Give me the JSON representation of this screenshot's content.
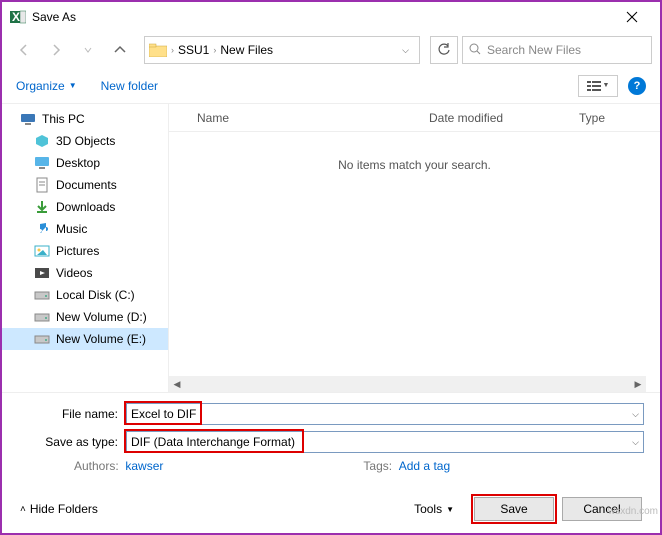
{
  "title": "Save As",
  "breadcrumbs": {
    "root_icon": "folder",
    "items": [
      "SSU1",
      "New Files"
    ]
  },
  "search": {
    "placeholder": "Search New Files"
  },
  "toolbar": {
    "organize": "Organize",
    "newfolder": "New folder"
  },
  "tree": [
    {
      "label": "This PC",
      "icon": "pc",
      "indent": false,
      "selected": false
    },
    {
      "label": "3D Objects",
      "icon": "3d",
      "indent": true,
      "selected": false
    },
    {
      "label": "Desktop",
      "icon": "desktop",
      "indent": true,
      "selected": false
    },
    {
      "label": "Documents",
      "icon": "documents",
      "indent": true,
      "selected": false
    },
    {
      "label": "Downloads",
      "icon": "downloads",
      "indent": true,
      "selected": false
    },
    {
      "label": "Music",
      "icon": "music",
      "indent": true,
      "selected": false
    },
    {
      "label": "Pictures",
      "icon": "pictures",
      "indent": true,
      "selected": false
    },
    {
      "label": "Videos",
      "icon": "videos",
      "indent": true,
      "selected": false
    },
    {
      "label": "Local Disk (C:)",
      "icon": "disk",
      "indent": true,
      "selected": false
    },
    {
      "label": "New Volume (D:)",
      "icon": "disk",
      "indent": true,
      "selected": false
    },
    {
      "label": "New Volume (E:)",
      "icon": "disk",
      "indent": true,
      "selected": true
    }
  ],
  "columns": {
    "name": "Name",
    "date": "Date modified",
    "type": "Type"
  },
  "empty_text": "No items match your search.",
  "filename": {
    "label": "File name:",
    "value": "Excel to DIF"
  },
  "filetype": {
    "label": "Save as type:",
    "value": "DIF (Data Interchange Format)"
  },
  "meta": {
    "authors_label": "Authors:",
    "authors_value": "kawser",
    "tags_label": "Tags:",
    "tags_value": "Add a tag"
  },
  "bottom": {
    "hidefolders": "Hide Folders",
    "tools": "Tools",
    "save": "Save",
    "cancel": "Cancel"
  },
  "watermark": "wsxdn.com",
  "colors": {
    "accent": "#0078d7",
    "link": "#0066cc",
    "highlight_border": "#d00"
  }
}
